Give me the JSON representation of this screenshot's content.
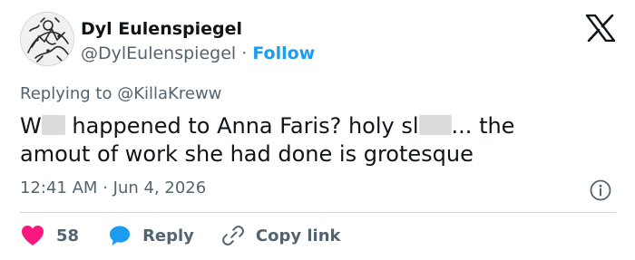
{
  "author": {
    "name": "Dyl Eulenspiegel",
    "handle": "@DylEulenspiegel",
    "separator": "·",
    "follow_label": "Follow"
  },
  "reply_context": {
    "prefix": "Replying to",
    "mention": "@KillaKreww"
  },
  "tweet": {
    "line1_a": "W",
    "line1_b": " happened to Anna Faris? holy sl",
    "line1_c": "... the",
    "line2": "amout of work she had done is grotesque"
  },
  "meta": {
    "time": "12:41 AM",
    "separator": "·",
    "date": "Jun 4, 2026"
  },
  "actions": {
    "like_count": "58",
    "reply_label": "Reply",
    "copy_label": "Copy link"
  },
  "icons": {
    "logo": "x-logo-icon",
    "info": "info-icon",
    "like": "heart-icon",
    "reply": "speech-bubble-icon",
    "copy": "link-icon"
  },
  "colors": {
    "text": "#0f1419",
    "secondary": "#536471",
    "accent": "#1d9bf0",
    "like": "#f91880",
    "divider": "#cfd9de"
  }
}
